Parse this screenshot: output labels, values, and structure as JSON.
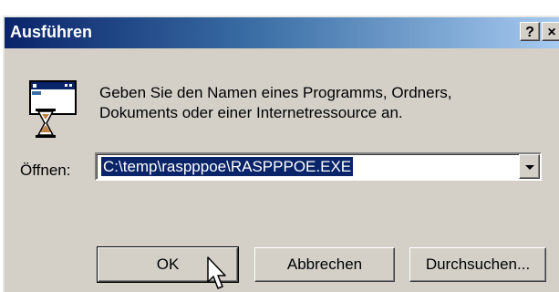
{
  "window": {
    "title": "Ausführen",
    "help_label": "?",
    "close_label": "×"
  },
  "message": {
    "line1": "Geben Sie den Namen eines Programms, Ordners,",
    "line2": "Dokuments oder einer Internetressource an."
  },
  "open_field": {
    "label": "Öffnen:",
    "value": "C:\\temp\\raspppoe\\RASPPPOE.EXE"
  },
  "buttons": {
    "ok": "OK",
    "cancel": "Abbrechen",
    "browse": "Durchsuchen..."
  },
  "icons": {
    "run": "run-program-hourglass-icon",
    "dropdown": "chevron-down-icon",
    "cursor": "mouse-pointer-icon"
  },
  "colors": {
    "title_gradient_start": "#0a246a",
    "title_gradient_end": "#a6caf0",
    "dialog_face": "#d4d0c8",
    "selection": "#0a246a"
  }
}
